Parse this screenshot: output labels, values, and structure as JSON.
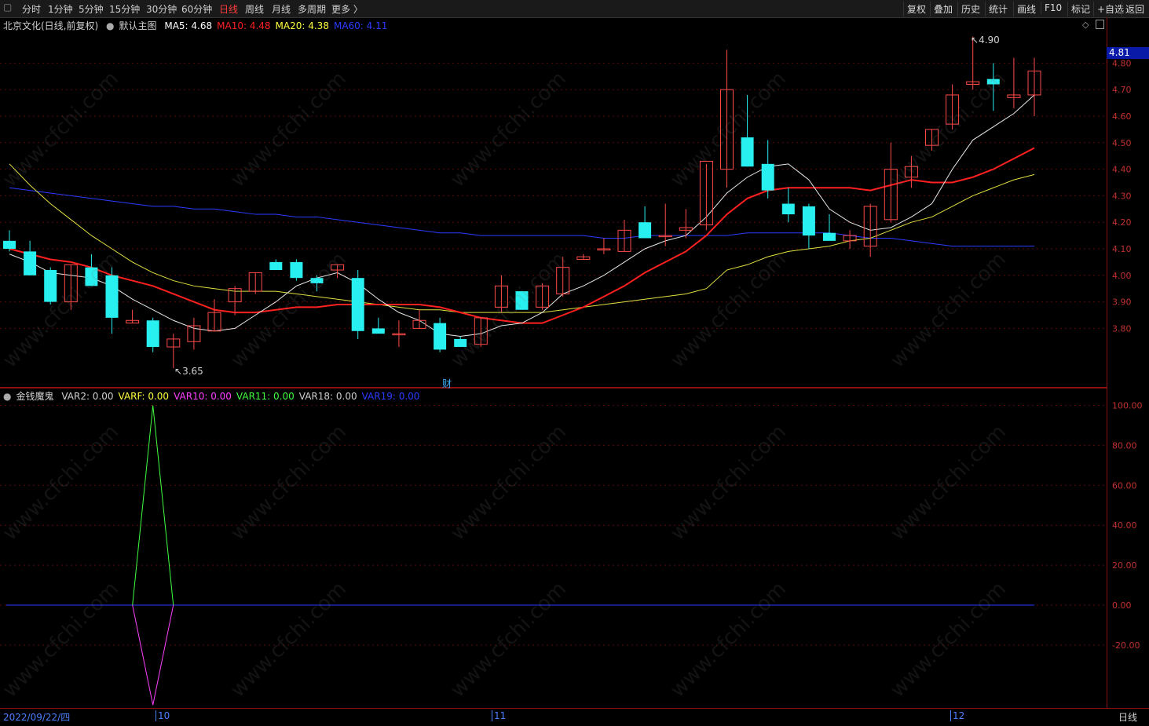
{
  "toolbar": {
    "periods": [
      "分时",
      "1分钟",
      "5分钟",
      "15分钟",
      "30分钟",
      "60分钟",
      "日线",
      "周线",
      "月线",
      "多周期",
      "更多 〉"
    ],
    "active_period": "日线",
    "actions": [
      "复权",
      "叠加",
      "历史",
      "统计",
      "画线",
      "F10",
      "标记",
      "+自选",
      "返回"
    ]
  },
  "main_legend": {
    "stock": "北京文化(日线,前复权)",
    "template": "默认主图",
    "items": [
      {
        "label": "MA5: 4.68",
        "color": "#ffffff"
      },
      {
        "label": "MA10: 4.48",
        "color": "#ff2020"
      },
      {
        "label": "MA20: 4.38",
        "color": "#ffff40"
      },
      {
        "label": "MA60: 4.11",
        "color": "#2a3cff"
      }
    ]
  },
  "sub_legend": {
    "name": "金钱魔鬼",
    "items": [
      {
        "label": "VAR2: 0.00",
        "color": "#d0d0d0"
      },
      {
        "label": "VARF: 0.00",
        "color": "#ffff40"
      },
      {
        "label": "VAR10: 0.00",
        "color": "#ff40ff"
      },
      {
        "label": "VAR11: 0.00",
        "color": "#40ff40"
      },
      {
        "label": "VAR18: 0.00",
        "color": "#d0d0d0"
      },
      {
        "label": "VAR19: 0.00",
        "color": "#2a3cff"
      }
    ]
  },
  "last_price_tag": "4.81",
  "max_annotation": "4.90",
  "min_annotation": "3.65",
  "event_marker": "财",
  "date_start": "2022/09/22/四",
  "month_labels": [
    "10",
    "11",
    "12"
  ],
  "period_badge": "日线",
  "watermark": "www.cfchi.com",
  "chart_data": {
    "type": "candlestick",
    "y_ticks": [
      4.8,
      4.7,
      4.6,
      4.5,
      4.4,
      4.3,
      4.2,
      4.1,
      4.0,
      3.9,
      3.8
    ],
    "y_tick_labels": [
      "4.80",
      "4.70",
      "4.60",
      "4.50",
      "4.40",
      "4.30",
      "4.20",
      "4.10",
      "4.00",
      "3.90",
      "3.80"
    ],
    "candles": [
      [
        4.13,
        4.17,
        4.09,
        4.1
      ],
      [
        4.09,
        4.13,
        4.0,
        4.0
      ],
      [
        4.02,
        4.03,
        3.89,
        3.9
      ],
      [
        3.9,
        4.04,
        3.87,
        4.04
      ],
      [
        4.03,
        4.08,
        3.96,
        3.96
      ],
      [
        4.0,
        4.03,
        3.78,
        3.84
      ],
      [
        3.82,
        3.87,
        3.82,
        3.83
      ],
      [
        3.83,
        3.84,
        3.71,
        3.73
      ],
      [
        3.73,
        3.78,
        3.65,
        3.76
      ],
      [
        3.75,
        3.84,
        3.72,
        3.81
      ],
      [
        3.79,
        3.91,
        3.79,
        3.86
      ],
      [
        3.9,
        3.96,
        3.85,
        3.95
      ],
      [
        3.94,
        4.01,
        3.93,
        4.01
      ],
      [
        4.05,
        4.06,
        4.02,
        4.02
      ],
      [
        4.05,
        4.06,
        3.98,
        3.99
      ],
      [
        3.99,
        4.0,
        3.94,
        3.97
      ],
      [
        4.02,
        4.04,
        3.99,
        4.04
      ],
      [
        3.99,
        4.02,
        3.76,
        3.79
      ],
      [
        3.8,
        3.84,
        3.79,
        3.78
      ],
      [
        3.78,
        3.83,
        3.73,
        3.78
      ],
      [
        3.8,
        3.87,
        3.8,
        3.83
      ],
      [
        3.82,
        3.84,
        3.71,
        3.72
      ],
      [
        3.76,
        3.77,
        3.73,
        3.73
      ],
      [
        3.74,
        3.84,
        3.73,
        3.84
      ],
      [
        3.88,
        4.0,
        3.86,
        3.96
      ],
      [
        3.94,
        3.94,
        3.87,
        3.87
      ],
      [
        3.88,
        3.97,
        3.87,
        3.96
      ],
      [
        3.93,
        4.07,
        3.92,
        4.03
      ],
      [
        4.06,
        4.08,
        4.06,
        4.07
      ],
      [
        4.1,
        4.14,
        4.08,
        4.1
      ],
      [
        4.09,
        4.21,
        4.09,
        4.17
      ],
      [
        4.2,
        4.26,
        4.14,
        4.14
      ],
      [
        4.15,
        4.27,
        4.11,
        4.15
      ],
      [
        4.17,
        4.25,
        4.14,
        4.18
      ],
      [
        4.19,
        4.42,
        4.17,
        4.43
      ],
      [
        4.4,
        4.85,
        4.33,
        4.7
      ],
      [
        4.52,
        4.68,
        4.41,
        4.41
      ],
      [
        4.42,
        4.51,
        4.29,
        4.32
      ],
      [
        4.27,
        4.33,
        4.2,
        4.23
      ],
      [
        4.26,
        4.27,
        4.1,
        4.15
      ],
      [
        4.16,
        4.23,
        4.13,
        4.13
      ],
      [
        4.13,
        4.17,
        4.1,
        4.15
      ],
      [
        4.11,
        4.27,
        4.07,
        4.26
      ],
      [
        4.21,
        4.5,
        4.2,
        4.4
      ],
      [
        4.37,
        4.45,
        4.33,
        4.41
      ],
      [
        4.49,
        4.55,
        4.47,
        4.55
      ],
      [
        4.57,
        4.72,
        4.55,
        4.68
      ],
      [
        4.72,
        4.9,
        4.7,
        4.73
      ],
      [
        4.74,
        4.8,
        4.62,
        4.72
      ],
      [
        4.67,
        4.82,
        4.63,
        4.68
      ],
      [
        4.68,
        4.82,
        4.6,
        4.77
      ]
    ],
    "ma5": [
      4.08,
      4.05,
      4.01,
      4.0,
      3.99,
      3.96,
      3.91,
      3.87,
      3.83,
      3.8,
      3.79,
      3.8,
      3.85,
      3.9,
      3.96,
      3.99,
      4.01,
      3.97,
      3.91,
      3.86,
      3.83,
      3.78,
      3.77,
      3.78,
      3.81,
      3.82,
      3.86,
      3.93,
      3.96,
      4.0,
      4.05,
      4.1,
      4.13,
      4.15,
      4.22,
      4.31,
      4.37,
      4.41,
      4.42,
      4.36,
      4.25,
      4.2,
      4.17,
      4.18,
      4.22,
      4.27,
      4.4,
      4.51,
      4.56,
      4.61,
      4.68
    ],
    "ma10": [
      4.1,
      4.08,
      4.06,
      4.05,
      4.03,
      4.0,
      3.98,
      3.96,
      3.93,
      3.9,
      3.87,
      3.86,
      3.86,
      3.87,
      3.88,
      3.88,
      3.89,
      3.89,
      3.89,
      3.89,
      3.89,
      3.88,
      3.86,
      3.84,
      3.83,
      3.82,
      3.82,
      3.85,
      3.88,
      3.92,
      3.96,
      4.01,
      4.05,
      4.09,
      4.15,
      4.23,
      4.29,
      4.32,
      4.33,
      4.33,
      4.33,
      4.33,
      4.32,
      4.34,
      4.36,
      4.35,
      4.35,
      4.37,
      4.4,
      4.44,
      4.48
    ],
    "ma20": [
      4.42,
      4.34,
      4.27,
      4.21,
      4.15,
      4.1,
      4.05,
      4.01,
      3.98,
      3.96,
      3.95,
      3.94,
      3.94,
      3.94,
      3.93,
      3.92,
      3.91,
      3.9,
      3.89,
      3.88,
      3.87,
      3.87,
      3.86,
      3.86,
      3.86,
      3.86,
      3.86,
      3.87,
      3.88,
      3.89,
      3.9,
      3.91,
      3.92,
      3.93,
      3.95,
      4.02,
      4.04,
      4.07,
      4.09,
      4.1,
      4.11,
      4.13,
      4.14,
      4.17,
      4.2,
      4.22,
      4.26,
      4.3,
      4.33,
      4.36,
      4.38
    ],
    "ma60": [
      4.33,
      4.32,
      4.31,
      4.3,
      4.29,
      4.28,
      4.27,
      4.26,
      4.26,
      4.25,
      4.25,
      4.24,
      4.23,
      4.23,
      4.22,
      4.22,
      4.21,
      4.2,
      4.19,
      4.18,
      4.17,
      4.16,
      4.16,
      4.15,
      4.15,
      4.15,
      4.15,
      4.15,
      4.15,
      4.14,
      4.14,
      4.15,
      4.15,
      4.15,
      4.15,
      4.15,
      4.16,
      4.16,
      4.16,
      4.16,
      4.16,
      4.15,
      4.14,
      4.14,
      4.13,
      4.12,
      4.11,
      4.11,
      4.11,
      4.11,
      4.11
    ],
    "indicator": {
      "y_ticks": [
        100,
        80,
        60,
        40,
        20,
        0,
        -20
      ],
      "y_tick_labels": [
        "100.00",
        "80.00",
        "60.00",
        "40.00",
        "20.00",
        "0.00",
        "-20.00"
      ],
      "pos_series": [
        0,
        0,
        0,
        0,
        0,
        0,
        0,
        100,
        0,
        0,
        0,
        0,
        0,
        0,
        0,
        0,
        0,
        0,
        0,
        0,
        0,
        0,
        0,
        0,
        0,
        0,
        0,
        0,
        0,
        0,
        0,
        0,
        0,
        0,
        0,
        0,
        0,
        0,
        0,
        0,
        0,
        0,
        0,
        0,
        0,
        0,
        0,
        0,
        0,
        0,
        0
      ],
      "neg_series": [
        0,
        0,
        0,
        0,
        0,
        0,
        0,
        -50,
        0,
        0,
        0,
        0,
        0,
        0,
        0,
        0,
        0,
        0,
        0,
        0,
        0,
        0,
        0,
        0,
        0,
        0,
        0,
        0,
        0,
        0,
        0,
        0,
        0,
        0,
        0,
        0,
        0,
        0,
        0,
        0,
        0,
        0,
        0,
        0,
        0,
        0,
        0,
        0,
        0,
        0,
        0
      ],
      "zero_line_color": "#2a3cff"
    }
  }
}
